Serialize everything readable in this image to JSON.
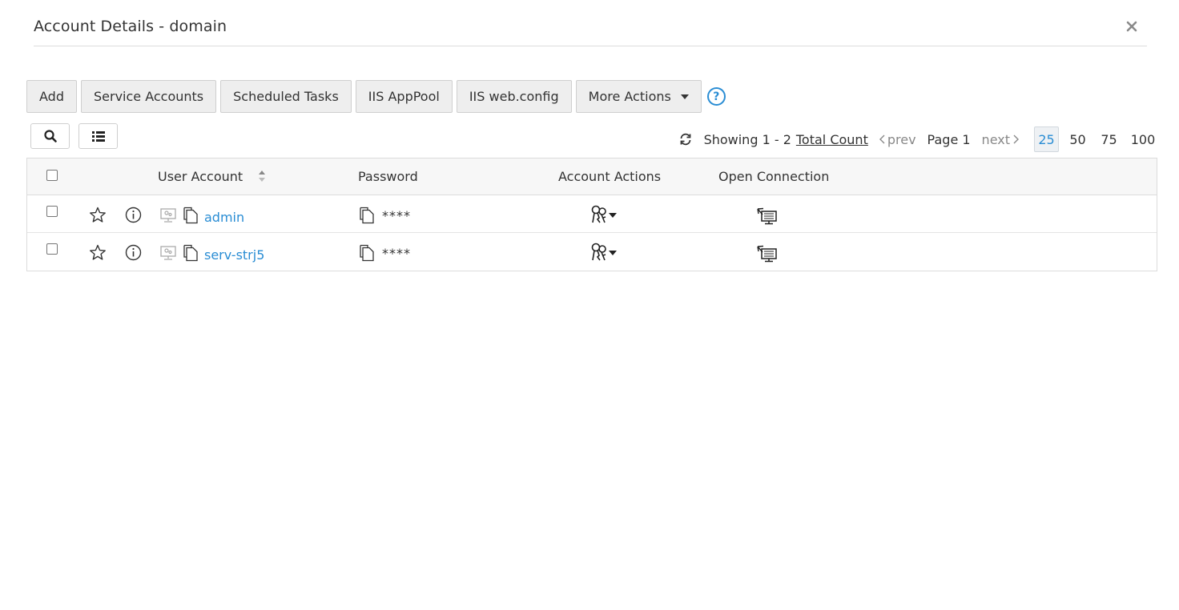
{
  "header": {
    "title": "Account Details - domain",
    "close_icon": "close-icon"
  },
  "toolbar": {
    "add_label": "Add",
    "service_accounts_label": "Service Accounts",
    "scheduled_tasks_label": "Scheduled Tasks",
    "iis_apppool_label": "IIS AppPool",
    "iis_webconfig_label": "IIS web.config",
    "more_actions_label": "More Actions",
    "help_icon": "?"
  },
  "pager": {
    "showing": "Showing 1 - 2",
    "total_count": "Total Count",
    "prev": "prev",
    "page": "Page 1",
    "next": "next",
    "sizes": [
      "25",
      "50",
      "75",
      "100"
    ],
    "active_size": "25"
  },
  "table": {
    "columns": {
      "user_account": "User Account",
      "password": "Password",
      "account_actions": "Account Actions",
      "open_connection": "Open Connection"
    },
    "rows": [
      {
        "user_account": "admin",
        "password": "****"
      },
      {
        "user_account": "serv-strj5",
        "password": "****"
      }
    ]
  },
  "colors": {
    "accent": "#2a8dd4",
    "button_bg": "#eeeeee",
    "header_bg": "#f7f7f7"
  }
}
